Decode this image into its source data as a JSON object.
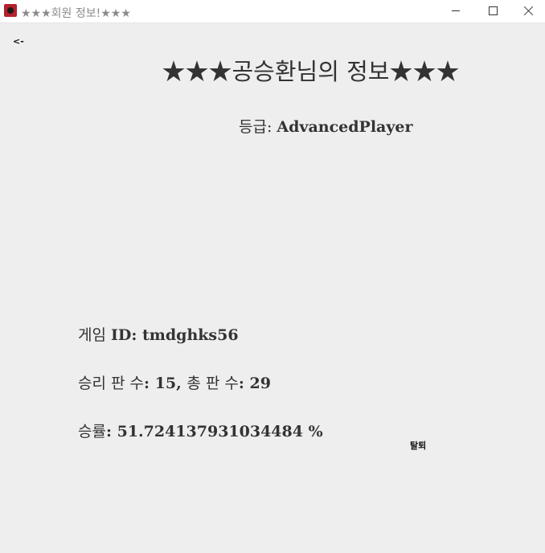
{
  "window": {
    "title": "★★★회원 정보!★★★",
    "icon": "app-icon",
    "controls": {
      "minimize": "minimize-icon",
      "maximize": "maximize-icon",
      "close": "close-icon"
    }
  },
  "nav": {
    "back_label": "<-"
  },
  "profile": {
    "heading": "★★★공승환님의 정보★★★",
    "grade_label": "등급: ",
    "grade_value": "AdvancedPlayer",
    "game_id_label": "게임 ",
    "game_id_value": "ID: tmdghks56",
    "stats_label_1": "승리 판 수",
    "stats_value_1": ": 15, ",
    "stats_label_2": "총 판 수",
    "stats_value_2": ": 29",
    "winrate_label": "승률",
    "winrate_value": ": 51.724137931034484 %"
  },
  "actions": {
    "withdraw_label": "탈퇴"
  },
  "colors": {
    "background": "#eeeeee",
    "text": "#333333",
    "titlebar": "#ffffff"
  }
}
